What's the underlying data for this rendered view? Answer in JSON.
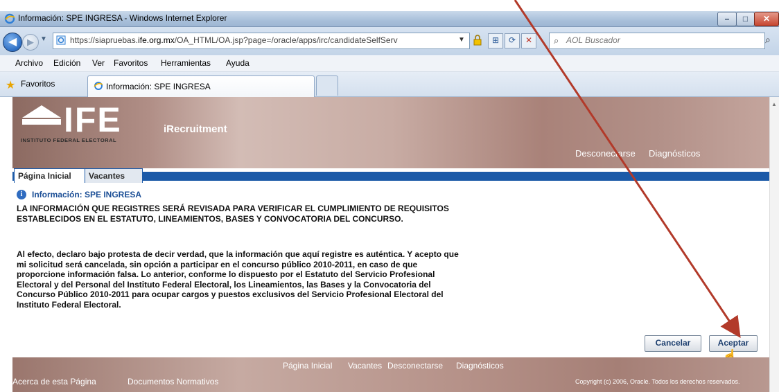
{
  "browser": {
    "window_title": "Información: SPE INGRESA - Windows Internet Explorer",
    "url_prefix": "https://siapruebas.",
    "url_domain": "ife.org.mx",
    "url_suffix": "/OA_HTML/OA.jsp?page=/oracle/apps/irc/candidateSelfServ",
    "search_placeholder": "AOL Buscador",
    "menu": [
      "Archivo",
      "Edición",
      "Ver",
      "Favoritos",
      "Herramientas",
      "Ayuda"
    ],
    "favorites_label": "Favoritos",
    "tab_title": "Información: SPE INGRESA"
  },
  "app": {
    "logo_text": "IFE",
    "logo_subtitle": "INSTITUTO FEDERAL ELECTORAL",
    "name": "iRecruitment",
    "header_links": [
      "Desconectarse",
      "Diagnósticos"
    ],
    "tabs": [
      "Página Inicial",
      "Vacantes"
    ]
  },
  "message": {
    "title": "Información: SPE INGRESA",
    "paragraph1": "LA INFORMACIÓN QUE REGISTRES SERÁ REVISADA PARA VERIFICAR EL CUMPLIMIENTO DE REQUISITOS ESTABLECIDOS EN EL ESTATUTO, LINEAMIENTOS, BASES Y CONVOCATORIA DEL CONCURSO.",
    "paragraph2": "Al efecto, declaro bajo protesta de decir verdad, que la información que aquí registre es auténtica. Y acepto que mi solicitud será cancelada, sin opción a participar en el concurso público 2010-2011, en caso de que proporcione información falsa. Lo anterior, conforme lo dispuesto por el Estatuto del Servicio Profesional Electoral y del Personal del Instituto Federal Electoral, los Lineamientos, las Bases y la Convocatoria del Concurso Público 2010-2011 para ocupar cargos y puestos exclusivos del Servicio Profesional Electoral del Instituto Federal Electoral."
  },
  "buttons": {
    "cancel": "Cancelar",
    "accept": "Aceptar"
  },
  "footer": {
    "links": [
      "Página Inicial",
      "Vacantes",
      "Desconectarse",
      "Diagnósticos"
    ],
    "about": "Acerca de esta Página",
    "docs": "Documentos Normativos",
    "copyright": "Copyright (c) 2006, Oracle. Todos los derechos reservados."
  },
  "colors": {
    "accent_blue": "#1c5aa8",
    "annotation_arrow": "#b23a2a"
  }
}
